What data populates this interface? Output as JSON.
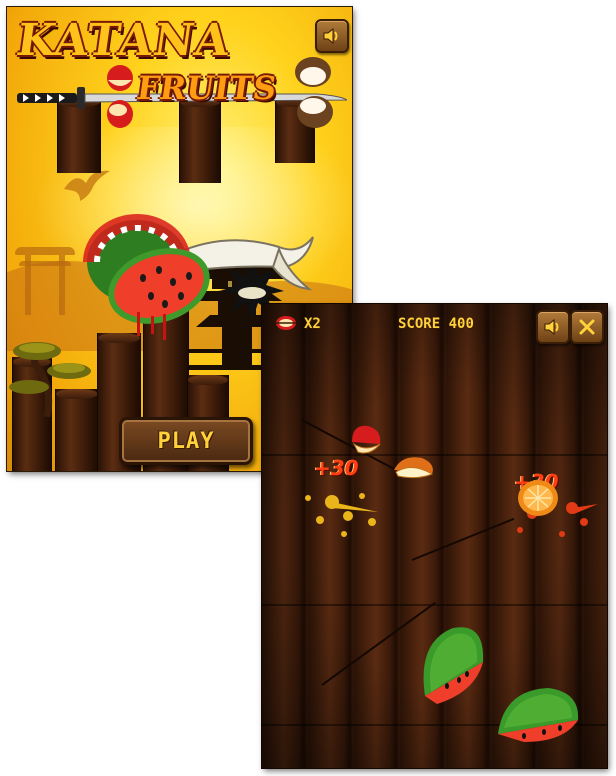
{
  "title_screen": {
    "logo": {
      "line1": "KATANA",
      "line2": "FRUITS"
    },
    "play_label": "PLAY",
    "sound_icon": "speaker-icon"
  },
  "game_screen": {
    "hud": {
      "multiplier_icon": "sliced-fruit-icon",
      "multiplier": "X2",
      "score_label": "SCORE",
      "score_value": "400"
    },
    "popups": [
      "+30",
      "+30"
    ],
    "buttons": {
      "sound_icon": "speaker-icon",
      "close_icon": "x-icon"
    }
  },
  "colors": {
    "logo_gold": "#ffc21a",
    "hud_text": "#ffd23a",
    "wood_dark": "#3b1a09",
    "popup_red": "#ff3f12",
    "sky_yellow": "#ffd21c"
  }
}
